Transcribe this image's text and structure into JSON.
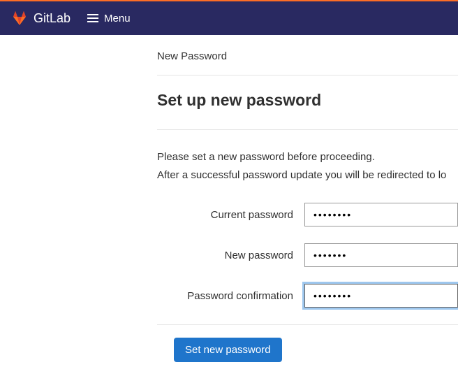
{
  "navbar": {
    "logo_text": "GitLab",
    "menu_label": "Menu"
  },
  "breadcrumb": "New Password",
  "title": "Set up new password",
  "instruction_line1": "Please set a new password before proceeding.",
  "instruction_line2": "After a successful password update you will be redirected to lo",
  "fields": {
    "current": {
      "label": "Current password",
      "value": "••••••••"
    },
    "new": {
      "label": "New password",
      "value": "•••••••"
    },
    "confirm": {
      "label": "Password confirmation",
      "value": "••••••••"
    }
  },
  "submit_label": "Set new password"
}
